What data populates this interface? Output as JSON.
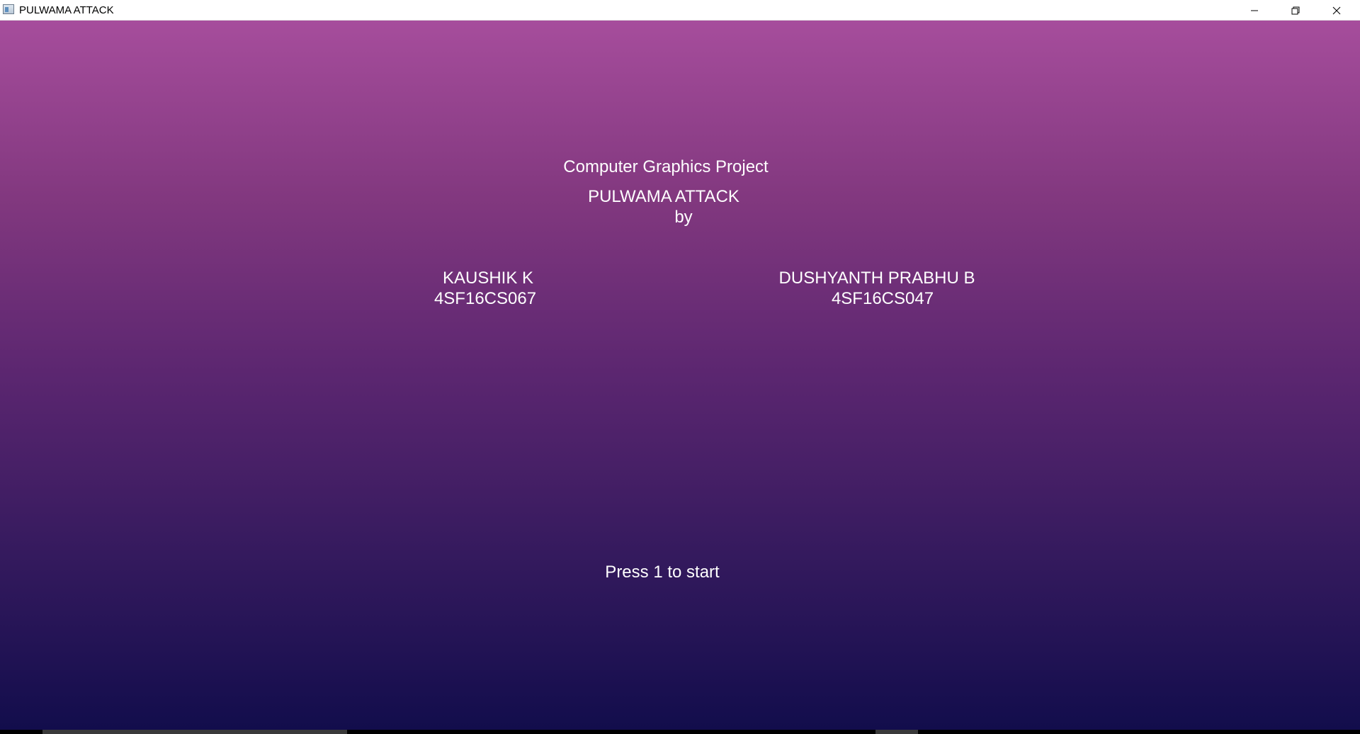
{
  "window": {
    "title": "PULWAMA ATTACK",
    "controls": {
      "minimize_icon": "minimize-icon",
      "restore_icon": "restore-icon",
      "close_icon": "close-icon"
    }
  },
  "scene": {
    "background_top_color": "#a64d9c",
    "background_bottom_color": "#120d4c",
    "text_color": "#ffffff",
    "project_label": "Computer Graphics Project",
    "project_title": "PULWAMA ATTACK",
    "by_label": "by",
    "authors": [
      {
        "name": "KAUSHIK K",
        "usn": "4SF16CS067"
      },
      {
        "name": "DUSHYANTH PRABHU B",
        "usn": "4SF16CS047"
      }
    ],
    "prompt": "Press 1 to start"
  }
}
